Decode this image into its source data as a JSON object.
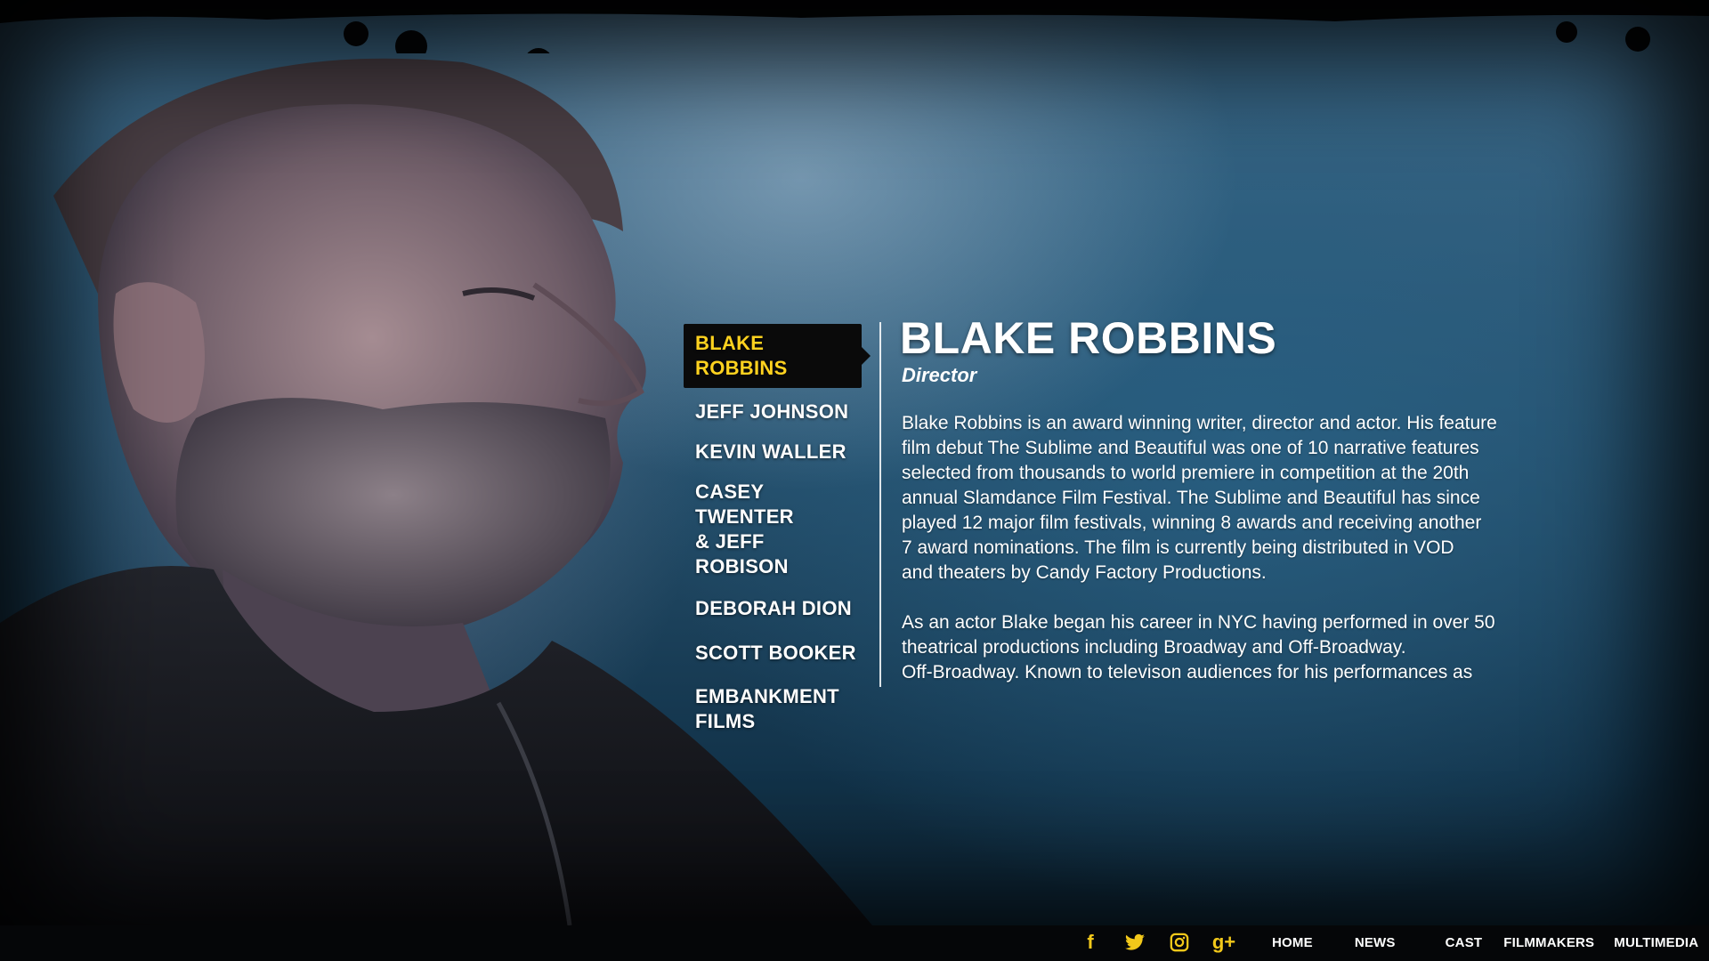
{
  "cast_menu": {
    "items": [
      {
        "label": "BLAKE ROBBINS",
        "active": true
      },
      {
        "label": "JEFF JOHNSON",
        "active": false
      },
      {
        "label": "KEVIN WALLER",
        "active": false
      },
      {
        "label": "CASEY TWENTER\n& JEFF ROBISON",
        "active": false
      },
      {
        "label": "DEBORAH DION",
        "active": false
      },
      {
        "label": "SCOTT BOOKER",
        "active": false
      },
      {
        "label": "EMBANKMENT\nFILMS",
        "active": false
      }
    ]
  },
  "bio": {
    "name": "BLAKE ROBBINS",
    "role": "Director",
    "paragraph1": "Blake Robbins is an award winning writer, director and actor. His feature\nfilm debut The Sublime and Beautiful was one of 10 narrative features\nselected from thousands to world premiere in competition at the 20th\nannual Slamdance Film Festival. The Sublime and Beautiful has since\nplayed 12 major film festivals, winning 8 awards and receiving another\n7 award nominations. The film is currently being distributed in VOD\nand theaters by Candy Factory Productions.",
    "paragraph2": "As an actor Blake began his career in NYC having performed in over 50\ntheatrical productions including Broadway and Off-Broadway.\nOff-Broadway. Known to televison audiences for his performances as"
  },
  "social": {
    "icons": [
      "facebook-icon",
      "twitter-icon",
      "instagram-icon",
      "google-plus-icon"
    ],
    "glyphs": {
      "facebook": "f",
      "google_plus": "g+"
    },
    "color": "#f2c81a"
  },
  "nav": {
    "home": "HOME",
    "news": "NEWS",
    "cast": "CAST",
    "filmmakers": "FILMMAKERS",
    "multimedia": "MULTIMEDIA"
  },
  "colors": {
    "accent": "#ffd21f",
    "active_bg": "#0a0a0a",
    "text": "#ffffff"
  }
}
